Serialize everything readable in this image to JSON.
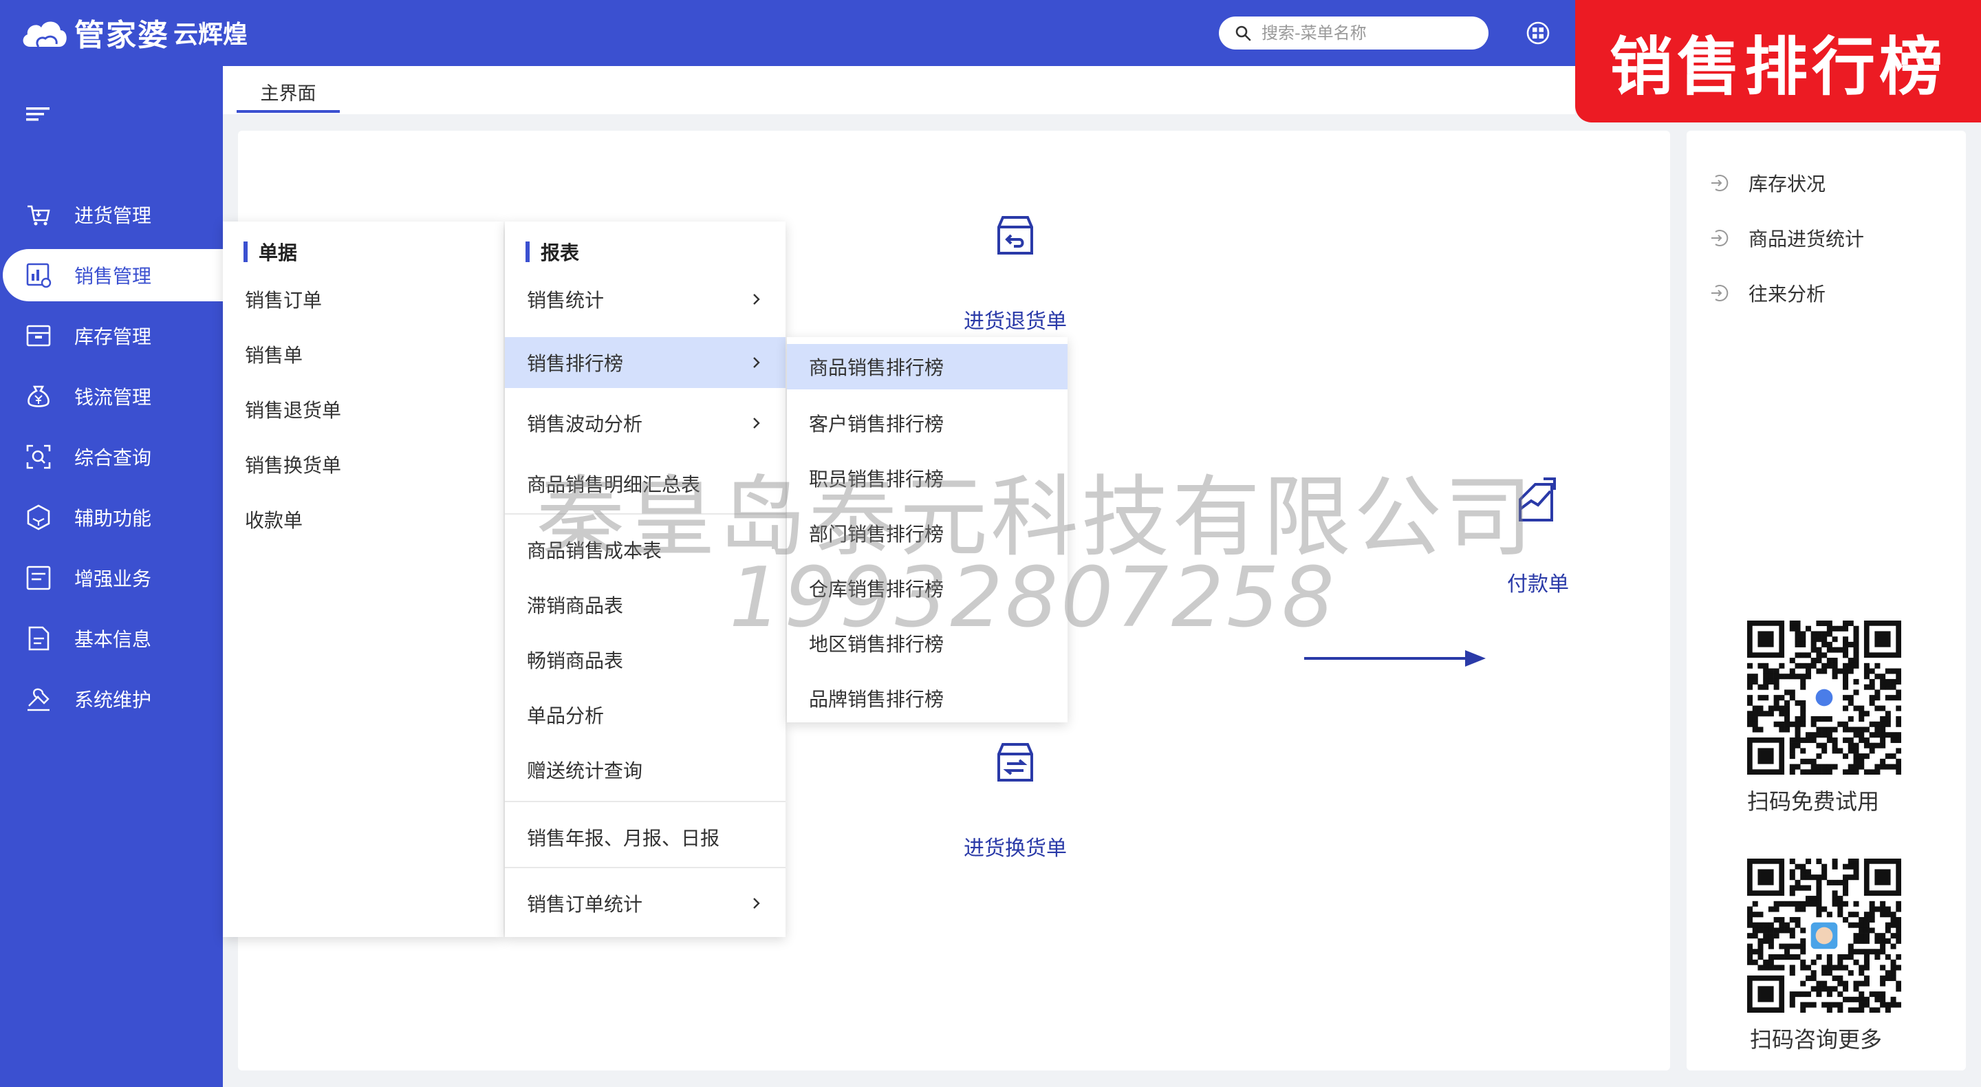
{
  "app": {
    "logo_name": "管家婆",
    "logo_sub": "云辉煌"
  },
  "search": {
    "placeholder": "搜索-菜单名称"
  },
  "promo": {
    "text": "销售排行榜"
  },
  "sidebar": {
    "items": [
      {
        "label": "进货管理",
        "icon": "cart-icon"
      },
      {
        "label": "销售管理",
        "icon": "sales-chart-icon",
        "active": true
      },
      {
        "label": "库存管理",
        "icon": "box-icon"
      },
      {
        "label": "钱流管理",
        "icon": "money-bag-icon"
      },
      {
        "label": "综合查询",
        "icon": "search-frame-icon"
      },
      {
        "label": "辅助功能",
        "icon": "hexagon-icon"
      },
      {
        "label": "增强业务",
        "icon": "list-icon"
      },
      {
        "label": "基本信息",
        "icon": "document-icon"
      },
      {
        "label": "系统维护",
        "icon": "tools-icon"
      }
    ]
  },
  "tabs": [
    {
      "label": "主界面"
    }
  ],
  "main": {
    "flow": [
      {
        "label": "进货退货单",
        "icon": "return-box-icon"
      },
      {
        "label": "付款单",
        "icon": "payment-icon"
      },
      {
        "label": "进货换货单",
        "icon": "exchange-box-icon"
      }
    ]
  },
  "right": {
    "quick_links": [
      {
        "label": "库存状况"
      },
      {
        "label": "商品进货统计"
      },
      {
        "label": "往来分析"
      }
    ],
    "qr": [
      {
        "caption": "扫码免费试用"
      },
      {
        "caption": "扫码咨询更多"
      }
    ]
  },
  "flyout": {
    "documents": {
      "title": "单据",
      "items": [
        "销售订单",
        "销售单",
        "销售退货单",
        "销售换货单",
        "收款单"
      ]
    },
    "reports": {
      "title": "报表",
      "items": [
        {
          "label": "销售统计",
          "submenu": true
        },
        {
          "label": "销售排行榜",
          "submenu": true,
          "highlighted": true
        },
        {
          "label": "销售波动分析",
          "submenu": true
        },
        {
          "label": "商品销售明细汇总表",
          "submenu": false
        },
        {
          "label": "商品销售成本表",
          "submenu": false
        },
        {
          "label": "滞销商品表",
          "submenu": false
        },
        {
          "label": "畅销商品表",
          "submenu": false
        },
        {
          "label": "单品分析",
          "submenu": false
        },
        {
          "label": "赠送统计查询",
          "submenu": false
        },
        {
          "label": "销售年报、月报、日报",
          "submenu": false
        },
        {
          "label": "销售订单统计",
          "submenu": true
        }
      ]
    },
    "ranking": {
      "items": [
        {
          "label": "商品销售排行榜",
          "highlighted": true
        },
        {
          "label": "客户销售排行榜"
        },
        {
          "label": "职员销售排行榜"
        },
        {
          "label": "部门销售排行榜"
        },
        {
          "label": "仓库销售排行榜"
        },
        {
          "label": "地区销售排行榜"
        },
        {
          "label": "品牌销售排行榜"
        }
      ]
    }
  },
  "watermark": {
    "company": "秦皇岛泰元科技有限公司",
    "phone": "19932807258"
  },
  "colors": {
    "brand": "#3b50d0",
    "promo": "#ec1b23",
    "highlight": "#d4e0fc"
  }
}
